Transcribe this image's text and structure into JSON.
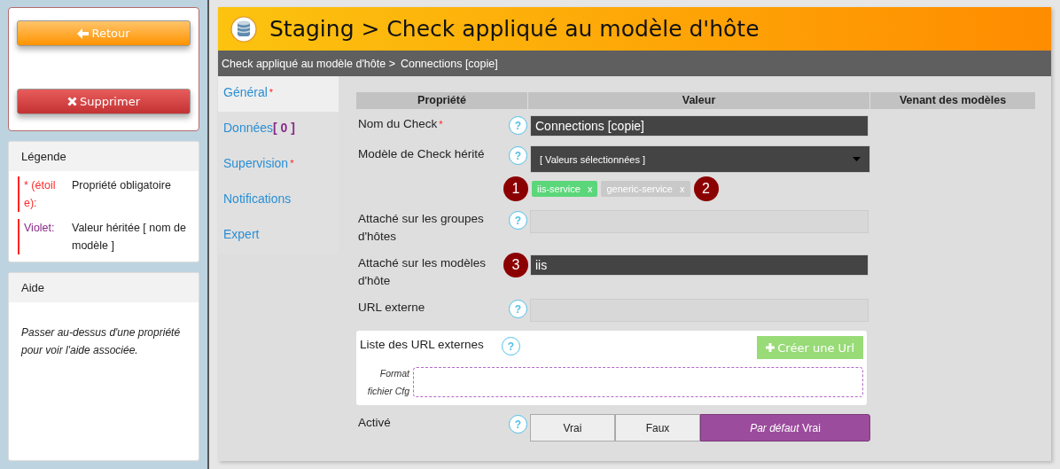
{
  "sidebar": {
    "buttons": [
      {
        "kind": "back",
        "label": "Retour"
      },
      {
        "kind": "delete",
        "label": "Supprimer"
      }
    ],
    "legend": {
      "title": "Légende",
      "items": [
        {
          "key": "* (étoile):",
          "meaning": "Propriété obligatoire",
          "color": "#ff2a2a"
        },
        {
          "key": "Violet:",
          "meaning": "Valeur héritée [ nom de modèle ]",
          "color": "#8a2a8a"
        }
      ]
    },
    "help": {
      "title": "Aide",
      "text": "Passer au-dessus d'une propriété pour voir l'aide associée."
    }
  },
  "header": {
    "title": "Staging > Check appliqué au modèle d'hôte"
  },
  "breadcrumb": [
    "Check appliqué au modèle d'hôte >",
    "Connections [copie]"
  ],
  "tabs": [
    {
      "label": "Général",
      "star": "*",
      "selected": true
    },
    {
      "label": "Données",
      "badge": "[ 0 ]",
      "selected": false
    },
    {
      "label": "Supervision",
      "star": "*",
      "selected": false
    },
    {
      "label": "Notifications",
      "selected": false
    },
    {
      "label": "Expert",
      "selected": false
    }
  ],
  "table": {
    "columns": [
      "Propriété",
      "Valeur",
      "Venant des modèles"
    ],
    "rows": [
      {
        "kind": "text",
        "label": "Nom du Check",
        "star": "*",
        "help": "?",
        "value": "Connections [copie]"
      },
      {
        "kind": "multiselect",
        "label": "Modèle de Check hérité",
        "help": "?",
        "value": "[ Valeurs sélectionnées ]",
        "chips": [
          {
            "kind": "marker",
            "label": "1"
          },
          {
            "kind": "tag",
            "label": "iis-service",
            "remove": "x",
            "color": "#5bd67a"
          },
          {
            "kind": "tag",
            "label": "generic-service",
            "remove": "x",
            "color": "#c9c9c9"
          },
          {
            "kind": "marker",
            "label": "2"
          }
        ]
      },
      {
        "kind": "empty",
        "label": "Attaché sur les groupes d'hôtes",
        "help": "?"
      },
      {
        "kind": "text",
        "label": "Attaché sur les modèles d'hôte",
        "marker": "3",
        "value": "iis"
      },
      {
        "kind": "empty",
        "label": "URL externe",
        "help": "?"
      },
      {
        "kind": "urllist",
        "label": "Liste des URL externes",
        "help": "?",
        "button": "Créer une Url",
        "format_label": "Format fichier Cfg"
      },
      {
        "kind": "toggle",
        "label": "Activé",
        "help": "?",
        "options": [
          {
            "label": "Vrai",
            "selected": false
          },
          {
            "label": "Faux",
            "selected": false
          },
          {
            "label": "*Par défaut* Vrai",
            "selected": true
          }
        ]
      }
    ]
  }
}
